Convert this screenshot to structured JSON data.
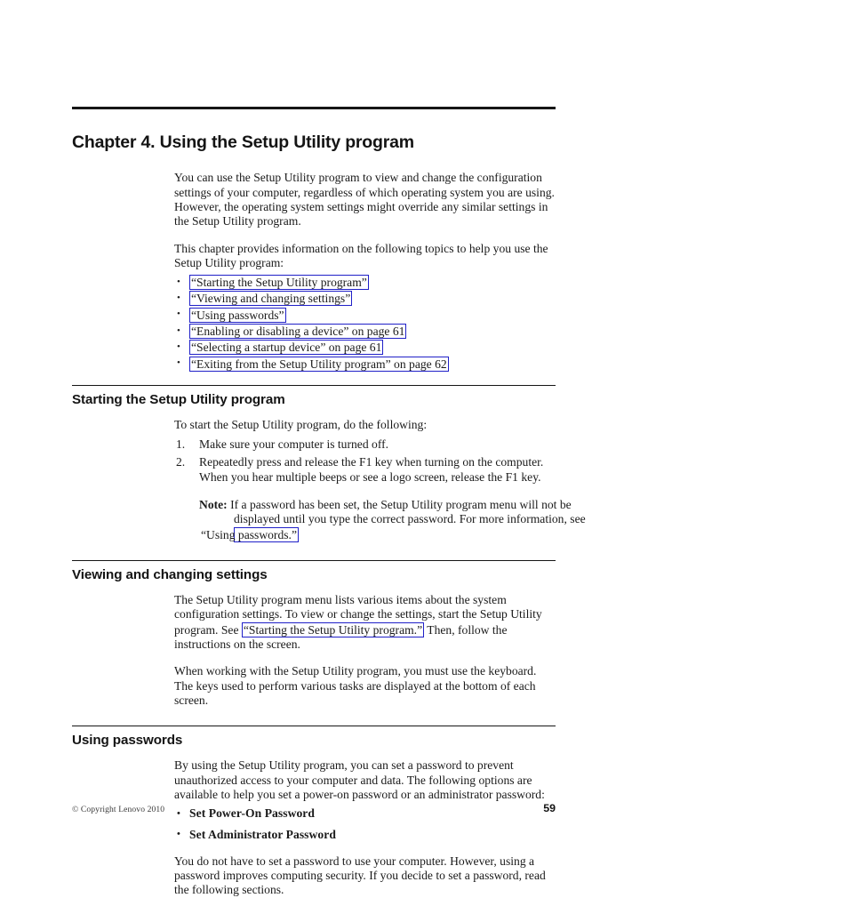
{
  "document": {
    "chapter_title": "Chapter 4. Using the Setup Utility program",
    "intro_paragraph": "You can use the Setup Utility program to view and change the configuration settings of your computer, regardless of which operating system you are using. However, the operating system settings might override any similar settings in the Setup Utility program.",
    "topics_lead": "This chapter provides information on the following topics to help you use the Setup Utility program:",
    "topics": [
      {
        "link_text": "“Starting the Setup Utility program”",
        "suffix": ""
      },
      {
        "link_text": "“Viewing and changing settings”",
        "suffix": ""
      },
      {
        "link_text": "“Using passwords”",
        "suffix": ""
      },
      {
        "link_text": "“Enabling or disabling a device” on page 61",
        "suffix": ""
      },
      {
        "link_text": "“Selecting a startup device” on page 61",
        "suffix": ""
      },
      {
        "link_text": "“Exiting from the Setup Utility program” on page 62",
        "suffix": ""
      }
    ]
  },
  "section_starting": {
    "heading": "Starting the Setup Utility program",
    "lead": "To start the Setup Utility program, do the following:",
    "steps": [
      "Make sure your computer is turned off.",
      "Repeatedly press and release the F1 key when turning on the computer. When you hear multiple beeps or see a logo screen, release the F1 key."
    ],
    "note_label": "Note:",
    "note_text": "If a password has been set, the Setup Utility program menu will not be displayed until you type the correct password. For more information, see",
    "note_link": "“Using passwords.”"
  },
  "section_viewing": {
    "heading": "Viewing and changing settings",
    "para1_before": "The Setup Utility program menu lists various items about the system configuration settings. To view or change the settings, start the Setup Utility program. See",
    "para1_link": "“Starting the Setup Utility program.”",
    "para1_after": "Then, follow the instructions on the screen.",
    "para2": "When working with the Setup Utility program, you must use the keyboard. The keys used to perform various tasks are displayed at the bottom of each screen."
  },
  "section_passwords": {
    "heading": "Using passwords",
    "para1": "By using the Setup Utility program, you can set a password to prevent unauthorized access to your computer and data. The following options are available to help you set a power-on password or an administrator password:",
    "options": [
      "Set Power-On Password",
      "Set Administrator Password"
    ],
    "para2": "You do not have to set a password to use your computer. However, using a password improves computing security. If you decide to set a password, read the following sections."
  },
  "footer": {
    "copyright": "© Copyright Lenovo 2010",
    "page_number": "59"
  },
  "colors": {
    "link_border": "#2020c8",
    "rule": "#161616",
    "text": "#1a1a1a"
  }
}
